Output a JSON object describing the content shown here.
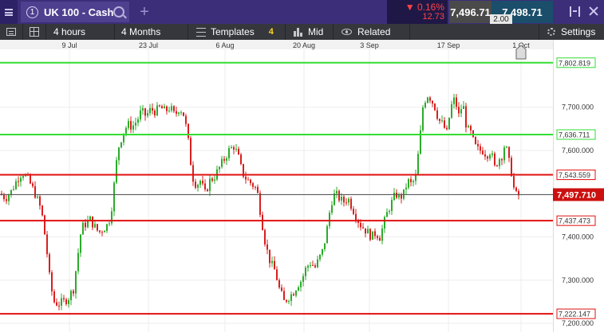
{
  "topbar": {
    "instrument_number": "1",
    "instrument_name": "UK 100 - Cash",
    "new_tab_symbol": "+",
    "change_percent": "▼ 0.16%",
    "change_points": "12.73",
    "sell_price": "7,496.71",
    "buy_price": "7,498.71",
    "spread": "2.00"
  },
  "toolbar": {
    "interval": "4 hours",
    "range": "4 Months",
    "templates_label": "Templates",
    "templates_count": "4",
    "price_type": "Mid",
    "related_label": "Related",
    "settings_label": "Settings"
  },
  "icons": {
    "menu": "hamburger-menu-icon",
    "search": "search-icon",
    "expand": "expand-icon",
    "close": "close-icon",
    "watchlist": "list-icon",
    "layout": "grid-layout-icon",
    "templates": "sliders-icon",
    "price_type": "candlestick-icon",
    "related": "eye-icon",
    "settings": "gear-icon",
    "current_time_marker": "current-time-marker-icon"
  },
  "colors": {
    "topbar": "#3d2e7a",
    "toolbar": "#35373d",
    "up_candle": "#2bab2b",
    "down_candle": "#d81f1f",
    "resistance_line": "#e01010",
    "green_line": "#33dd33",
    "current_price_tag": "#cc1010"
  },
  "chart_data": {
    "type": "candlestick",
    "instrument": "UK 100 - Cash",
    "interval": "4 hours",
    "x_tick_labels": [
      "9 Jul",
      "23 Jul",
      "6 Aug",
      "20 Aug",
      "3 Sep",
      "17 Sep",
      "1 Oct"
    ],
    "y_tick_labels": [
      "7,200.000",
      "7,300.000",
      "7,400.000",
      "7,500.000",
      "7,600.000",
      "7,700.000"
    ],
    "ylim": [
      7180,
      7830
    ],
    "grid": true,
    "current_price": 7497.71,
    "current_price_label": "7,497.710",
    "horizontal_lines": [
      {
        "value": 7802.819,
        "label": "7,802.819",
        "color": "green"
      },
      {
        "value": 7636.711,
        "label": "7,636.711",
        "color": "green"
      },
      {
        "value": 7543.559,
        "label": "7,543.559",
        "color": "red"
      },
      {
        "value": 7437.473,
        "label": "7,437.473",
        "color": "red"
      },
      {
        "value": 7222.147,
        "label": "7,222.147",
        "color": "red"
      }
    ],
    "close_path": [
      [
        0,
        7500
      ],
      [
        7,
        7490
      ],
      [
        14,
        7505
      ],
      [
        22,
        7535
      ],
      [
        28,
        7550
      ],
      [
        36,
        7530
      ],
      [
        44,
        7500
      ],
      [
        52,
        7460
      ],
      [
        58,
        7380
      ],
      [
        63,
        7290
      ],
      [
        68,
        7250
      ],
      [
        73,
        7245
      ],
      [
        80,
        7250
      ],
      [
        86,
        7260
      ],
      [
        92,
        7280
      ],
      [
        97,
        7350
      ],
      [
        102,
        7420
      ],
      [
        107,
        7430
      ],
      [
        113,
        7440
      ],
      [
        118,
        7425
      ],
      [
        124,
        7410
      ],
      [
        130,
        7420
      ],
      [
        136,
        7430
      ],
      [
        141,
        7480
      ],
      [
        145,
        7560
      ],
      [
        149,
        7610
      ],
      [
        154,
        7640
      ],
      [
        160,
        7660
      ],
      [
        166,
        7655
      ],
      [
        172,
        7670
      ],
      [
        177,
        7690
      ],
      [
        183,
        7680
      ],
      [
        189,
        7695
      ],
      [
        195,
        7690
      ],
      [
        201,
        7700
      ],
      [
        207,
        7690
      ],
      [
        213,
        7700
      ],
      [
        219,
        7680
      ],
      [
        225,
        7700
      ],
      [
        231,
        7680
      ],
      [
        236,
        7620
      ],
      [
        241,
        7540
      ],
      [
        246,
        7520
      ],
      [
        251,
        7530
      ],
      [
        257,
        7500
      ],
      [
        263,
        7530
      ],
      [
        269,
        7540
      ],
      [
        275,
        7560
      ],
      [
        281,
        7580
      ],
      [
        287,
        7600
      ],
      [
        293,
        7610
      ],
      [
        298,
        7590
      ],
      [
        302,
        7560
      ],
      [
        306,
        7540
      ],
      [
        311,
        7530
      ],
      [
        317,
        7520
      ],
      [
        322,
        7510
      ],
      [
        327,
        7450
      ],
      [
        333,
        7380
      ],
      [
        339,
        7340
      ],
      [
        345,
        7320
      ],
      [
        350,
        7280
      ],
      [
        356,
        7250
      ],
      [
        361,
        7260
      ],
      [
        367,
        7270
      ],
      [
        373,
        7290
      ],
      [
        378,
        7300
      ],
      [
        384,
        7330
      ],
      [
        389,
        7340
      ],
      [
        395,
        7330
      ],
      [
        400,
        7350
      ],
      [
        405,
        7370
      ],
      [
        410,
        7420
      ],
      [
        415,
        7480
      ],
      [
        420,
        7500
      ],
      [
        425,
        7490
      ],
      [
        430,
        7480
      ],
      [
        436,
        7490
      ],
      [
        441,
        7470
      ],
      [
        446,
        7450
      ],
      [
        451,
        7430
      ],
      [
        456,
        7420
      ],
      [
        461,
        7410
      ],
      [
        466,
        7400
      ],
      [
        471,
        7410
      ],
      [
        476,
        7400
      ],
      [
        481,
        7430
      ],
      [
        486,
        7460
      ],
      [
        491,
        7480
      ],
      [
        496,
        7500
      ],
      [
        501,
        7490
      ],
      [
        506,
        7500
      ],
      [
        511,
        7530
      ],
      [
        516,
        7520
      ],
      [
        521,
        7540
      ],
      [
        526,
        7620
      ],
      [
        530,
        7700
      ],
      [
        535,
        7730
      ],
      [
        540,
        7720
      ],
      [
        545,
        7700
      ],
      [
        550,
        7670
      ],
      [
        555,
        7660
      ],
      [
        560,
        7640
      ],
      [
        565,
        7700
      ],
      [
        570,
        7720
      ],
      [
        575,
        7680
      ],
      [
        580,
        7710
      ],
      [
        585,
        7650
      ],
      [
        590,
        7640
      ],
      [
        595,
        7610
      ],
      [
        600,
        7600
      ],
      [
        605,
        7600
      ],
      [
        610,
        7590
      ],
      [
        615,
        7600
      ],
      [
        620,
        7560
      ],
      [
        625,
        7580
      ],
      [
        630,
        7590
      ],
      [
        633,
        7620
      ],
      [
        637,
        7580
      ],
      [
        641,
        7550
      ],
      [
        645,
        7500
      ],
      [
        648,
        7495
      ],
      [
        652,
        7497
      ]
    ]
  }
}
